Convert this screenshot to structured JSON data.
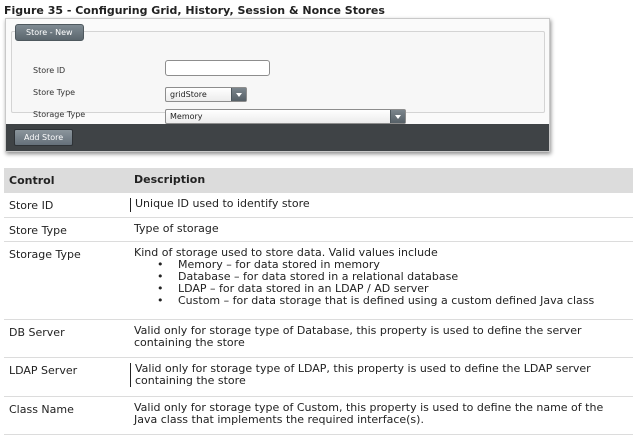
{
  "figure_caption": "Figure 35 - Configuring Grid, History, Session & Nonce Stores",
  "dialog": {
    "legend": "Store - New",
    "fields": {
      "store_id_label": "Store ID",
      "store_id_value": "",
      "store_type_label": "Store Type",
      "store_type_value": "gridStore",
      "storage_type_label": "Storage Type",
      "storage_type_value": "Memory"
    },
    "add_button": "Add Store"
  },
  "table": {
    "header": {
      "control": "Control",
      "description": "Description"
    },
    "rows": [
      {
        "control": "Store ID",
        "description": "Unique ID used to identify store"
      },
      {
        "control": "Store Type",
        "description": "Type of storage"
      },
      {
        "control": "Storage Type",
        "description": "Kind of storage used to store data. Valid values include",
        "bullets": [
          "Memory – for data stored in memory",
          "Database – for data stored in a relational database",
          "LDAP – for data stored in an LDAP / AD server",
          "Custom – for data storage that is defined using a custom defined Java class"
        ]
      },
      {
        "control": "DB Server",
        "description": "Valid only for storage type of Database, this property is used to define the server containing the store"
      },
      {
        "control": "LDAP Server",
        "description": "Valid only for storage type of LDAP, this property is used to define the LDAP server containing the store"
      },
      {
        "control": "Class Name",
        "description": "Valid only for storage type of Custom, this property is used to define the name of the Java class that implements the required interface(s)."
      }
    ]
  }
}
